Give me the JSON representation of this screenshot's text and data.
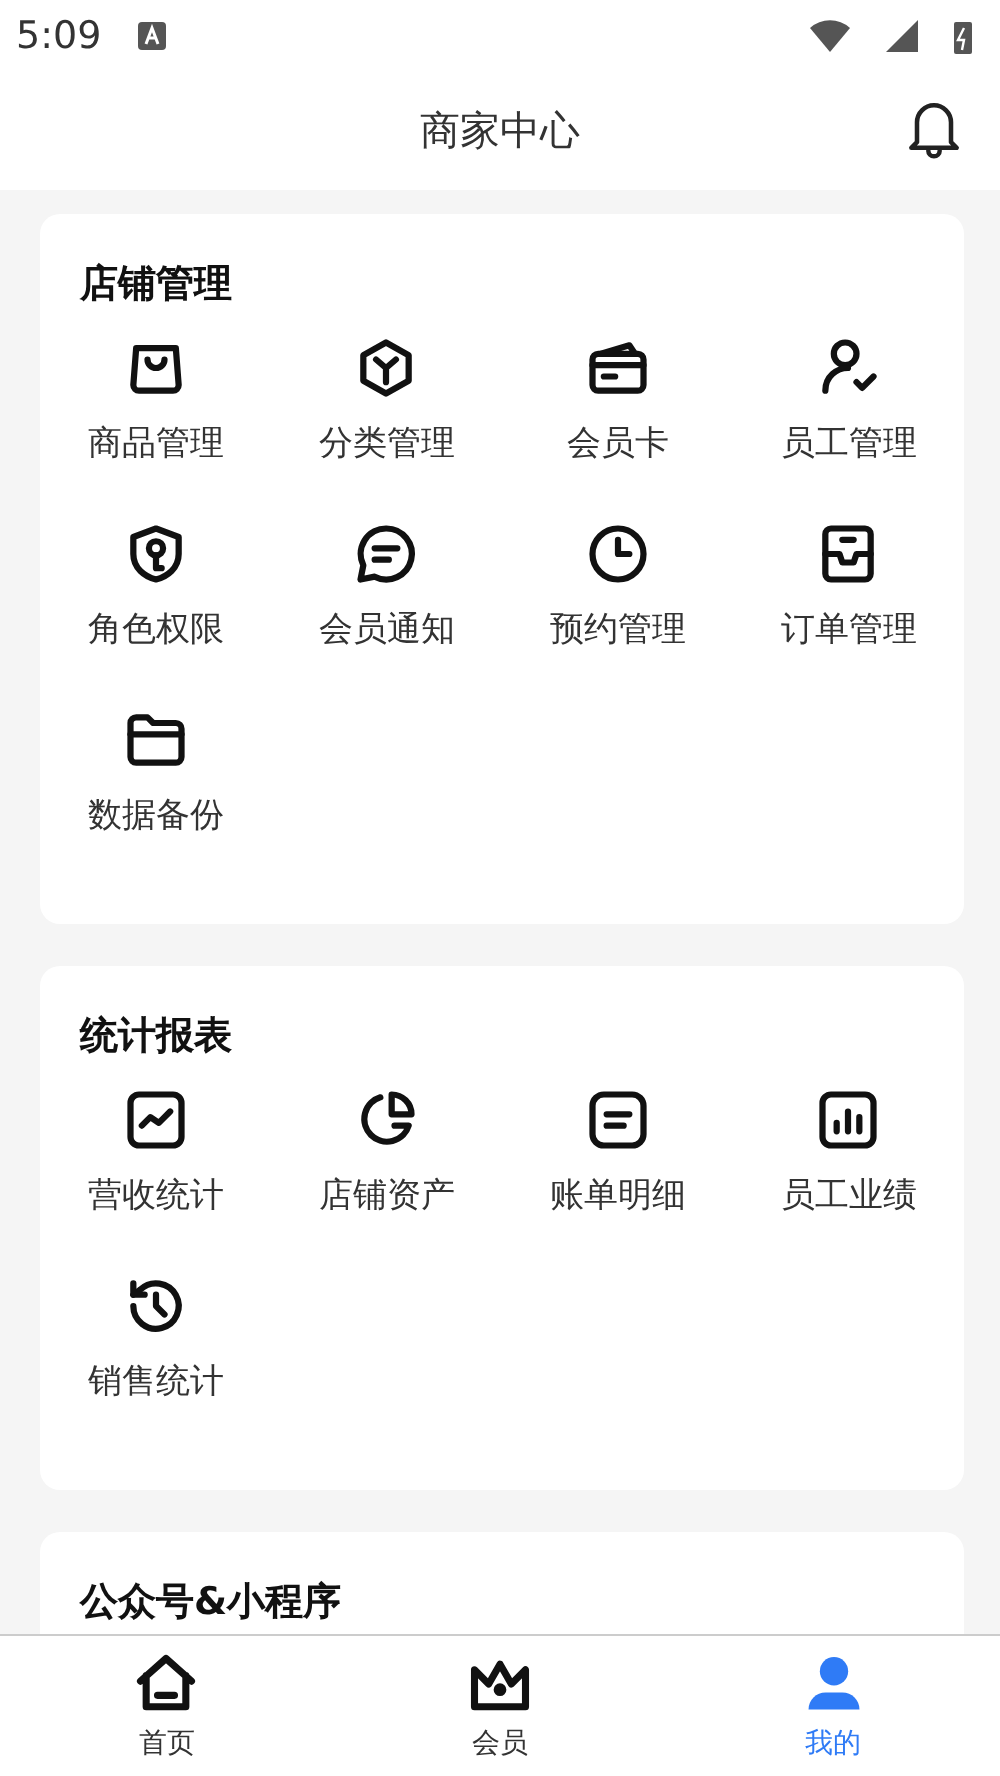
{
  "status_bar": {
    "time": "5:09"
  },
  "header": {
    "title": "商家中心"
  },
  "sections": [
    {
      "title": "店铺管理",
      "items": [
        "商品管理",
        "分类管理",
        "会员卡",
        "员工管理",
        "角色权限",
        "会员通知",
        "预约管理",
        "订单管理",
        "数据备份"
      ]
    },
    {
      "title": "统计报表",
      "items": [
        "营收统计",
        "店铺资产",
        "账单明细",
        "员工业绩",
        "销售统计"
      ]
    },
    {
      "title": "公众号&小程序"
    }
  ],
  "tab_bar": [
    {
      "label": "首页",
      "selected": false
    },
    {
      "label": "会员",
      "selected": false
    },
    {
      "label": "我的",
      "selected": true
    }
  ]
}
